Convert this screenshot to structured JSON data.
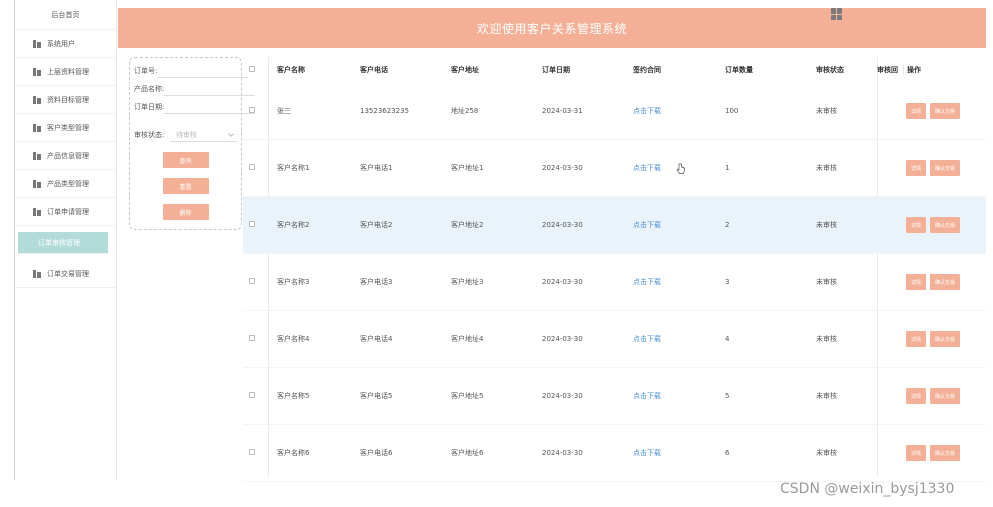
{
  "sidebar": {
    "home": "后台首页",
    "items": [
      {
        "label": "系统用户",
        "icon": "user-icon"
      },
      {
        "label": "上层资料管理",
        "icon": "folder-icon"
      },
      {
        "label": "资料目标管理",
        "icon": "folder-icon"
      },
      {
        "label": "客户类型管理",
        "icon": "folder-icon"
      },
      {
        "label": "产品信息管理",
        "icon": "folder-icon"
      },
      {
        "label": "产品类型管理",
        "icon": "folder-icon"
      },
      {
        "label": "订单申请管理",
        "icon": "folder-icon"
      },
      {
        "label": "订单审核管理",
        "icon": "folder-icon",
        "active": true
      },
      {
        "label": "订单交易管理",
        "icon": "folder-icon"
      }
    ]
  },
  "header": {
    "title": "欢迎使用客户关系管理系统",
    "bg_color": "#f4b096"
  },
  "filter": {
    "order_no_label": "订单号:",
    "product_name_label": "产品名称:",
    "order_date_label": "订单日期:",
    "status_label": "审核状态:",
    "status_placeholder": "待审核",
    "search_btn": "查询",
    "reset_btn": "重置",
    "delete_btn": "删除"
  },
  "table": {
    "headers": {
      "name": "客户名称",
      "phone": "客户电话",
      "addr": "客户地址",
      "date": "订单日期",
      "contract": "签约合同",
      "qty": "订单数量",
      "status": "审核状态",
      "status2": "审核回",
      "ops": "操作"
    },
    "rows": [
      {
        "name": "张三",
        "phone": "13523623235",
        "addr": "地址258",
        "date": "2024-03-31",
        "contract": "点击下载",
        "qty": "100",
        "status": "未审核",
        "op1": "详情",
        "op2": "确认交易"
      },
      {
        "name": "客户名称1",
        "phone": "客户电话1",
        "addr": "客户地址1",
        "date": "2024-03-30",
        "contract": "点击下载",
        "qty": "1",
        "status": "未审核",
        "op1": "详情",
        "op2": "确认交易"
      },
      {
        "name": "客户名称2",
        "phone": "客户电话2",
        "addr": "客户地址2",
        "date": "2024-03-30",
        "contract": "点击下载",
        "qty": "2",
        "status": "未审核",
        "op1": "详情",
        "op2": "确认交易"
      },
      {
        "name": "客户名称3",
        "phone": "客户电话3",
        "addr": "客户地址3",
        "date": "2024-03-30",
        "contract": "点击下载",
        "qty": "3",
        "status": "未审核",
        "op1": "详情",
        "op2": "确认交易"
      },
      {
        "name": "客户名称4",
        "phone": "客户电话4",
        "addr": "客户地址4",
        "date": "2024-03-30",
        "contract": "点击下载",
        "qty": "4",
        "status": "未审核",
        "op1": "详情",
        "op2": "确认交易"
      },
      {
        "name": "客户名称5",
        "phone": "客户电话5",
        "addr": "客户地址5",
        "date": "2024-03-30",
        "contract": "点击下载",
        "qty": "5",
        "status": "未审核",
        "op1": "详情",
        "op2": "确认交易"
      },
      {
        "name": "客户名称6",
        "phone": "客户电话6",
        "addr": "客户地址6",
        "date": "2024-03-30",
        "contract": "点击下载",
        "qty": "6",
        "status": "未审核",
        "op1": "详情",
        "op2": "确认交易"
      }
    ]
  },
  "watermark": "CSDN @weixin_bysj1330",
  "colors": {
    "accent": "#f4b096",
    "active_nav": "#b3dcd9",
    "link": "#4b8fd6",
    "highlight_row": "#ebf3fa"
  }
}
